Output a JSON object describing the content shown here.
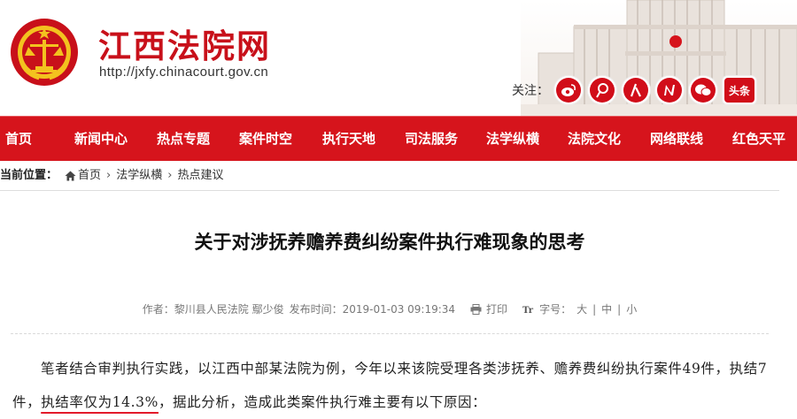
{
  "site": {
    "title": "江西法院网",
    "url": "http://jxfy.chinacourt.gov.cn"
  },
  "follow": {
    "label": "关注：",
    "icons": [
      "weibo-icon",
      "tencent-weibo-icon",
      "people-icon",
      "netease-icon",
      "wechat-icon",
      "toutiao-icon"
    ],
    "toutiao_text": "头条"
  },
  "nav": {
    "items": [
      "首页",
      "新闻中心",
      "热点专题",
      "案件时空",
      "执行天地",
      "司法服务",
      "法学纵横",
      "法院文化",
      "网络联线",
      "红色天平"
    ]
  },
  "breadcrumb": {
    "label": "当前位置：",
    "items": [
      "首页",
      "法学纵横",
      "热点建议"
    ]
  },
  "article": {
    "title": "关于对涉抚养赡养费纠纷案件执行难现象的思考",
    "meta": {
      "author": "作者：黎川县人民法院  鄢少俊",
      "published": "发布时间：2019-01-03 09:19:34",
      "print": "打印",
      "fontsize_label": "字号：",
      "size_large": "大",
      "size_medium": "中",
      "size_small": "小"
    },
    "para_before": "笔者结合审判执行实践，以江西中部某法院为例，今年以来该院受理各类涉抚养、赡养费纠纷执行案件49件，执结7件，",
    "para_highlight": "执结率仅为14.3%",
    "para_after": "，据此分析，造成此类案件执行难主要有以下原因："
  },
  "colors": {
    "brand_red": "#d6141c",
    "title_red": "#c8101a"
  }
}
